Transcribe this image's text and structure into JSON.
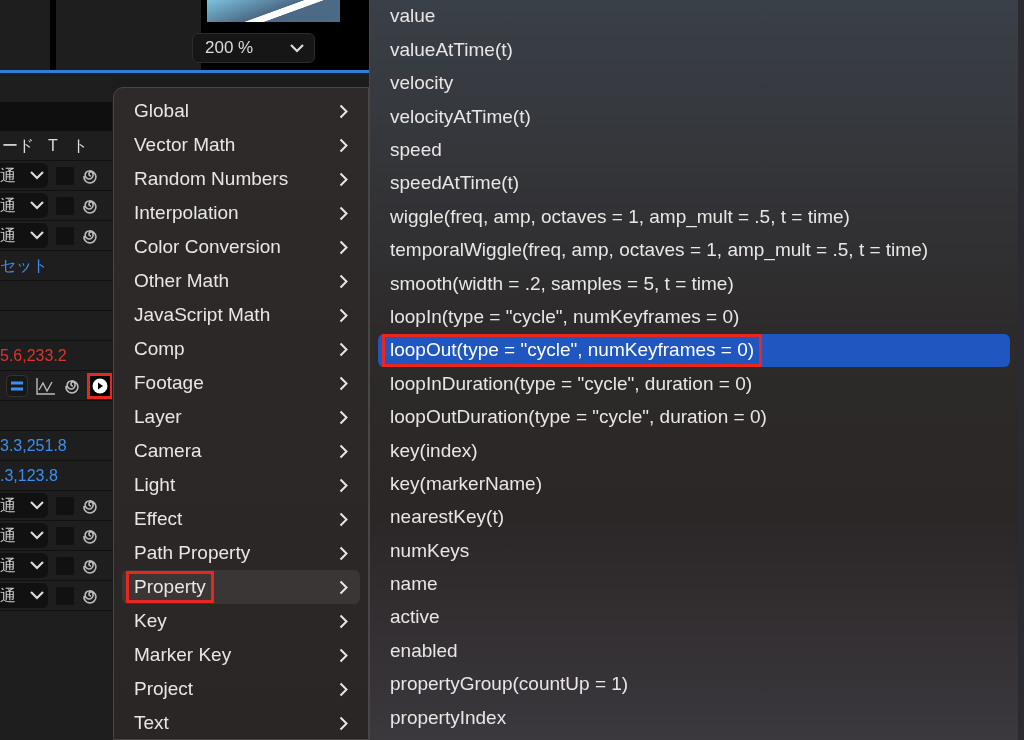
{
  "viewer": {
    "zoom": "200 %"
  },
  "layer_panel": {
    "header": [
      "ード",
      "T",
      "ト"
    ],
    "rows": [
      {
        "kind": "blank"
      },
      {
        "kind": "bar"
      },
      {
        "kind": "header"
      },
      {
        "kind": "mode",
        "mode": "通",
        "checked": false
      },
      {
        "kind": "mode",
        "mode": "通",
        "checked": false
      },
      {
        "kind": "mode",
        "mode": "通",
        "checked": false
      },
      {
        "kind": "link",
        "text": "セット"
      },
      {
        "kind": "blank"
      },
      {
        "kind": "blank"
      },
      {
        "kind": "values",
        "text": "5.6,233.2",
        "color": "#e0332f"
      },
      {
        "kind": "tools",
        "highlighted": true
      },
      {
        "kind": "blank"
      },
      {
        "kind": "values",
        "text": "3.3,251.8",
        "color": "#3b8ff0"
      },
      {
        "kind": "values",
        "text": ".3,123.8",
        "color": "#3b8ff0"
      },
      {
        "kind": "mode",
        "mode": "通",
        "checked": false
      },
      {
        "kind": "mode",
        "mode": "通",
        "checked": false
      },
      {
        "kind": "mode",
        "mode": "通",
        "checked": false
      },
      {
        "kind": "mode",
        "mode": "通",
        "checked": false
      }
    ]
  },
  "menu": {
    "items": [
      {
        "label": "Global",
        "selected": false,
        "highlighted": false
      },
      {
        "label": "Vector Math",
        "selected": false,
        "highlighted": false
      },
      {
        "label": "Random Numbers",
        "selected": false,
        "highlighted": false
      },
      {
        "label": "Interpolation",
        "selected": false,
        "highlighted": false
      },
      {
        "label": "Color Conversion",
        "selected": false,
        "highlighted": false
      },
      {
        "label": "Other Math",
        "selected": false,
        "highlighted": false
      },
      {
        "label": "JavaScript Math",
        "selected": false,
        "highlighted": false
      },
      {
        "label": "Comp",
        "selected": false,
        "highlighted": false
      },
      {
        "label": "Footage",
        "selected": false,
        "highlighted": false
      },
      {
        "label": "Layer",
        "selected": false,
        "highlighted": false
      },
      {
        "label": "Camera",
        "selected": false,
        "highlighted": false
      },
      {
        "label": "Light",
        "selected": false,
        "highlighted": false
      },
      {
        "label": "Effect",
        "selected": false,
        "highlighted": false
      },
      {
        "label": "Path Property",
        "selected": false,
        "highlighted": false
      },
      {
        "label": "Property",
        "selected": true,
        "highlighted": true
      },
      {
        "label": "Key",
        "selected": false,
        "highlighted": false
      },
      {
        "label": "Marker Key",
        "selected": false,
        "highlighted": false
      },
      {
        "label": "Project",
        "selected": false,
        "highlighted": false
      },
      {
        "label": "Text",
        "selected": false,
        "highlighted": false
      }
    ]
  },
  "submenu": {
    "items": [
      {
        "label": "value",
        "selected": false,
        "highlighted": false
      },
      {
        "label": "valueAtTime(t)",
        "selected": false,
        "highlighted": false
      },
      {
        "label": "velocity",
        "selected": false,
        "highlighted": false
      },
      {
        "label": "velocityAtTime(t)",
        "selected": false,
        "highlighted": false
      },
      {
        "label": "speed",
        "selected": false,
        "highlighted": false
      },
      {
        "label": "speedAtTime(t)",
        "selected": false,
        "highlighted": false
      },
      {
        "label": "wiggle(freq, amp, octaves = 1, amp_mult = .5, t = time)",
        "selected": false,
        "highlighted": false
      },
      {
        "label": "temporalWiggle(freq, amp, octaves = 1, amp_mult = .5, t = time)",
        "selected": false,
        "highlighted": false
      },
      {
        "label": "smooth(width = .2, samples = 5, t = time)",
        "selected": false,
        "highlighted": false
      },
      {
        "label": "loopIn(type = \"cycle\", numKeyframes = 0)",
        "selected": false,
        "highlighted": false
      },
      {
        "label": "loopOut(type = \"cycle\", numKeyframes = 0)",
        "selected": true,
        "highlighted": true
      },
      {
        "label": "loopInDuration(type = \"cycle\", duration = 0)",
        "selected": false,
        "highlighted": false
      },
      {
        "label": "loopOutDuration(type = \"cycle\", duration = 0)",
        "selected": false,
        "highlighted": false
      },
      {
        "label": "key(index)",
        "selected": false,
        "highlighted": false
      },
      {
        "label": "key(markerName)",
        "selected": false,
        "highlighted": false
      },
      {
        "label": "nearestKey(t)",
        "selected": false,
        "highlighted": false
      },
      {
        "label": "numKeys",
        "selected": false,
        "highlighted": false
      },
      {
        "label": "name",
        "selected": false,
        "highlighted": false
      },
      {
        "label": "active",
        "selected": false,
        "highlighted": false
      },
      {
        "label": "enabled",
        "selected": false,
        "highlighted": false
      },
      {
        "label": "propertyGroup(countUp = 1)",
        "selected": false,
        "highlighted": false
      },
      {
        "label": "propertyIndex",
        "selected": false,
        "highlighted": false
      }
    ]
  }
}
